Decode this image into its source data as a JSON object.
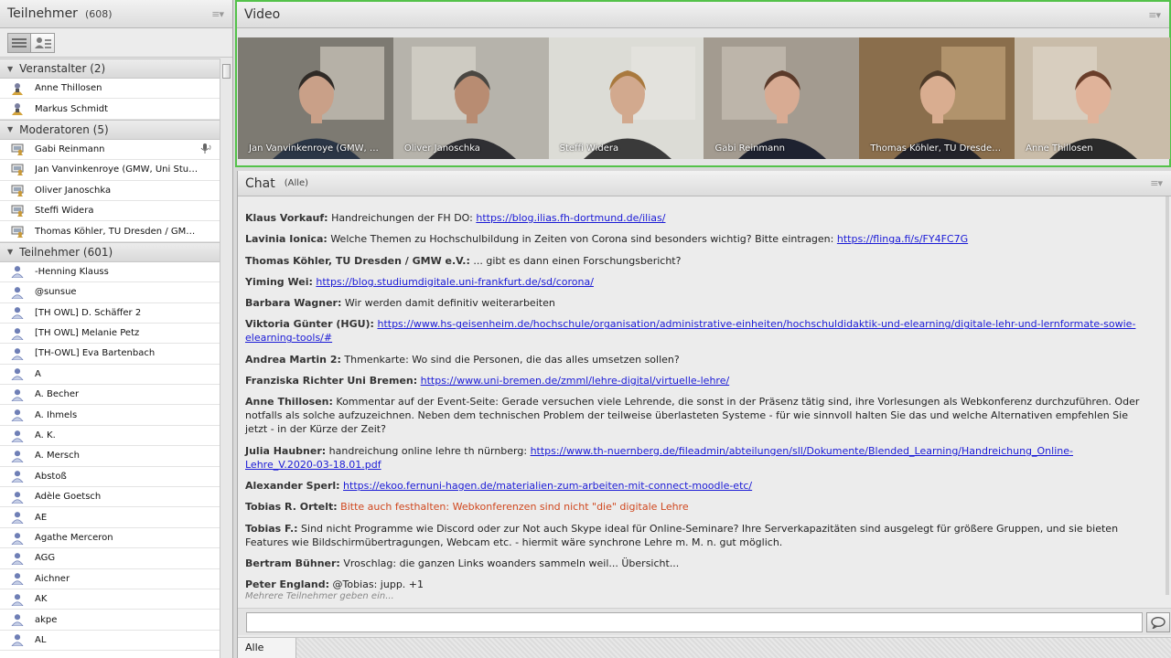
{
  "attendees": {
    "title": "Teilnehmer",
    "count": "(608)",
    "groups": [
      {
        "label": "Veranstalter (2)",
        "role": "host",
        "items": [
          "Anne Thillosen",
          "Markus Schmidt"
        ]
      },
      {
        "label": "Moderatoren (5)",
        "role": "presenter",
        "items": [
          "Gabi Reinmann",
          "Jan Vanvinkenroye (GMW, Uni Stut…",
          "Oliver Janoschka",
          "Steffi Widera",
          "Thomas Köhler, TU Dresden / GMW…"
        ]
      },
      {
        "label": "Teilnehmer (601)",
        "role": "participant",
        "items": [
          "-Henning Klauss",
          "@sunsue",
          "[TH OWL] D. Schäffer 2",
          "[TH OWL] Melanie Petz",
          "[TH-OWL] Eva Bartenbach",
          "A",
          "A. Becher",
          "A. Ihmels",
          "A. K.",
          "A. Mersch",
          "Abstoß",
          "Adèle Goetsch",
          "AE",
          "Agathe Merceron",
          "AGG",
          "Aichner",
          "AK",
          "akpe",
          "AL"
        ]
      }
    ]
  },
  "video": {
    "title": "Video",
    "tiles": [
      {
        "name": "Jan Vanvinkenroye (GMW, …",
        "bg": "#7d7a72",
        "wall": "#cfc9bd",
        "skin": "#c9a088",
        "shirt": "#2b3646",
        "hair": "#2f2a26"
      },
      {
        "name": "Oliver Janoschka",
        "bg": "#b6b3ab",
        "wall": "#d9d5cc",
        "skin": "#b88c72",
        "shirt": "#2f2f33",
        "hair": "#4a4742"
      },
      {
        "name": "Steffi Widera",
        "bg": "#dcdcd6",
        "wall": "#e6e4df",
        "skin": "#d2a98e",
        "shirt": "#3a3a3a",
        "hair": "#a9793e"
      },
      {
        "name": "Gabi Reinmann",
        "bg": "#a39b90",
        "wall": "#c7c0b5",
        "skin": "#d8ab93",
        "shirt": "#1e2230",
        "hair": "#5a3a2a"
      },
      {
        "name": "Thomas Köhler, TU Dresde…",
        "bg": "#8a6e4c",
        "wall": "#c2a27a",
        "skin": "#d9ad90",
        "shirt": "#23232a",
        "hair": "#4d3a28"
      },
      {
        "name": "Anne Thillosen",
        "bg": "#c9bca9",
        "wall": "#ded6c9",
        "skin": "#e0b39a",
        "shirt": "#2a2a2a",
        "hair": "#6a3e2a"
      }
    ]
  },
  "chat": {
    "title": "Chat",
    "filter": "(Alle)",
    "messages": [
      {
        "sender": "Klaus Vorkauf:",
        "text": "Handreichungen der FH DO: ",
        "link": "https://blog.ilias.fh-dortmund.de/ilias/"
      },
      {
        "sender": "Lavinia Ionica:",
        "text": "Welche Themen zu Hochschulbildung in Zeiten von Corona sind besonders wichtig? Bitte eintragen: ",
        "link": "https://flinga.fi/s/FY4FC7G"
      },
      {
        "sender": "Thomas Köhler, TU Dresden / GMW e.V.:",
        "text": "... gibt es dann einen Forschungsbericht?"
      },
      {
        "sender": "Yiming Wei:",
        "text": "",
        "link": "https://blog.studiumdigitale.uni-frankfurt.de/sd/corona/"
      },
      {
        "sender": "Barbara Wagner:",
        "text": "Wir werden damit definitiv weiterarbeiten"
      },
      {
        "sender": "Viktoria Günter (HGU):",
        "text": "",
        "link": "https://www.hs-geisenheim.de/hochschule/organisation/administrative-einheiten/hochschuldidaktik-und-elearning/digitale-lehr-und-lernformate-sowie-elearning-tools/#"
      },
      {
        "sender": "Andrea Martin 2:",
        "text": "Thmenkarte: Wo sind die Personen, die das alles umsetzen sollen?"
      },
      {
        "sender": "Franziska Richter Uni Bremen:",
        "text": "",
        "link": "https://www.uni-bremen.de/zmml/lehre-digital/virtuelle-lehre/"
      },
      {
        "sender": "Anne Thillosen:",
        "text": "Kommentar auf der Event-Seite: Gerade versuchen viele Lehrende, die sonst in der Präsenz tätig sind, ihre Vorlesungen als Webkonferenz durchzuführen. Oder notfalls als solche aufzuzeichnen. Neben dem technischen Problem der teilweise überlasteten Systeme - für wie sinnvoll halten Sie das und welche Alternativen empfehlen Sie jetzt - in der Kürze der Zeit?"
      },
      {
        "sender": "Julia Haubner:",
        "text": "handreichung online lehre th nürnberg: ",
        "link": "https://www.th-nuernberg.de/fileadmin/abteilungen/sll/Dokumente/Blended_Learning/Handreichung_Online-Lehre_V.2020-03-18.01.pdf"
      },
      {
        "sender": "Alexander Sperl:",
        "text": "",
        "link": "https://ekoo.fernuni-hagen.de/materialien-zum-arbeiten-mit-connect-moodle-etc/"
      },
      {
        "sender": "Tobias R. Ortelt:",
        "text": "",
        "highlight": "Bitte auch festhalten: Webkonferenzen sind nicht \"die\" digitale Lehre"
      },
      {
        "sender": "Tobias F.:",
        "text": "Sind nicht Programme wie Discord oder zur Not auch Skype ideal für Online-Seminare? Ihre Serverkapazitäten sind ausgelegt für größere Gruppen, und sie bieten Features wie Bildschirmübertragungen, Webcam etc. - hiermit wäre synchrone Lehre m. M. n. gut möglich."
      },
      {
        "sender": "Bertram Bühner:",
        "text": "Vroschlag: die ganzen Links woanders sammeln weil... Übersicht..."
      },
      {
        "sender": "Peter England:",
        "text": "@Tobias: jupp. +1"
      }
    ],
    "typing": "Mehrere Teilnehmer geben ein...",
    "input_value": "",
    "tab_label": "Alle"
  },
  "colors": {
    "active_border": "#54c24a",
    "link": "#1a1ad6",
    "highlight": "#d0471e"
  },
  "icons": {
    "host": "host-person-icon",
    "presenter": "presenter-screen-icon",
    "participant": "participant-person-icon",
    "speaking": "microphone-icon",
    "send": "speech-bubble-icon"
  }
}
